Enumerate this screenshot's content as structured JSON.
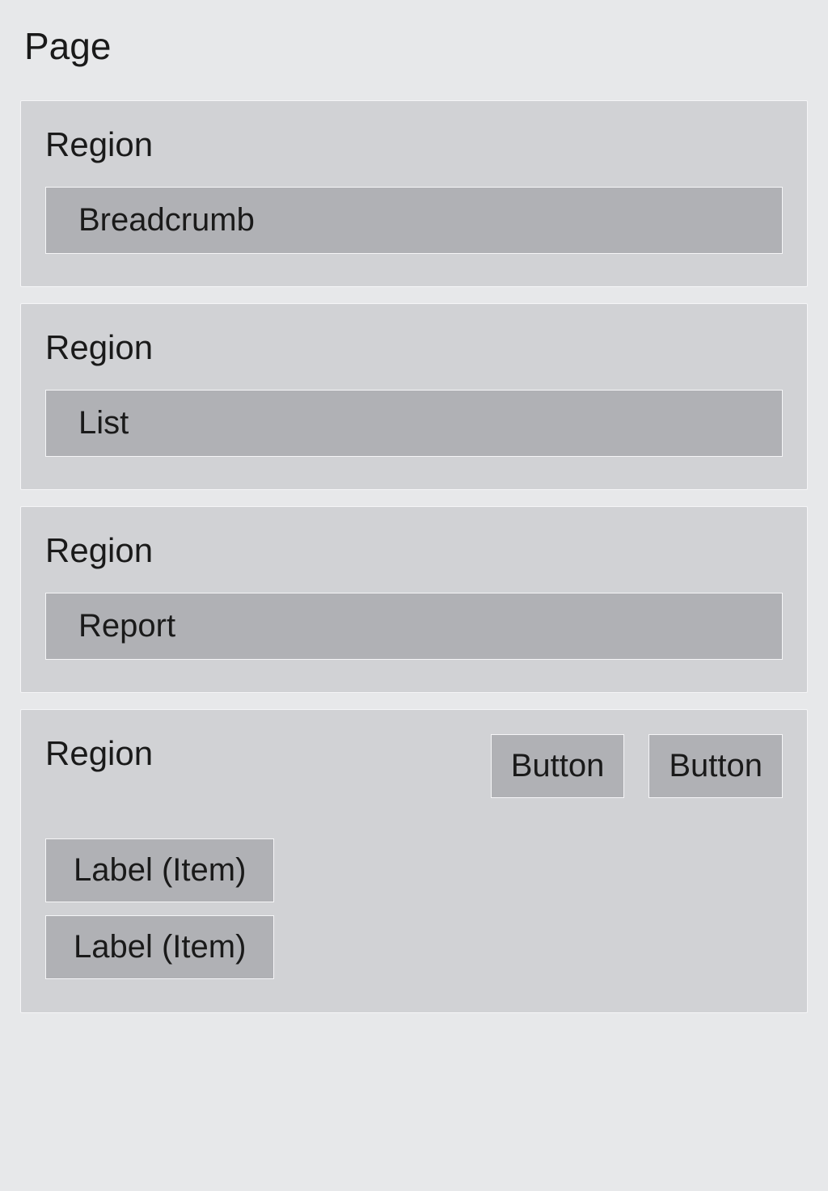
{
  "page": {
    "title": "Page"
  },
  "regions": [
    {
      "title": "Region",
      "content_label": "Breadcrumb"
    },
    {
      "title": "Region",
      "content_label": "List"
    },
    {
      "title": "Region",
      "content_label": "Report"
    },
    {
      "title": "Region",
      "buttons": [
        "Button",
        "Button"
      ],
      "labels": [
        "Label (Item)",
        "Label (Item)"
      ]
    }
  ]
}
